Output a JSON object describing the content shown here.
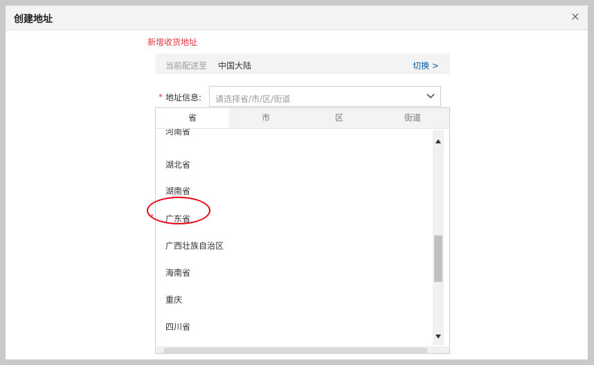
{
  "dialog": {
    "title": "创建地址",
    "close_glyph": "×"
  },
  "section_title": "新增收货地址",
  "deliver": {
    "label": "当前配送至",
    "value": "中国大陆",
    "switch_label": "切换 >"
  },
  "field": {
    "required_mark": "*",
    "label": "地址信息:",
    "placeholder": "请选择省/市/区/街道"
  },
  "tabs": [
    {
      "label": "省",
      "active": true
    },
    {
      "label": "市",
      "active": false
    },
    {
      "label": "区",
      "active": false
    },
    {
      "label": "街道",
      "active": false
    }
  ],
  "provinces": [
    "河南省",
    "湖北省",
    "湖南省",
    "广东省",
    "广西壮族自治区",
    "海南省",
    "重庆",
    "四川省"
  ],
  "annotation": {
    "mark": "*",
    "highlighted": "广东省",
    "color": "#e60012"
  },
  "colors": {
    "accent_red": "#e4393c",
    "link_blue": "#005ea7"
  }
}
